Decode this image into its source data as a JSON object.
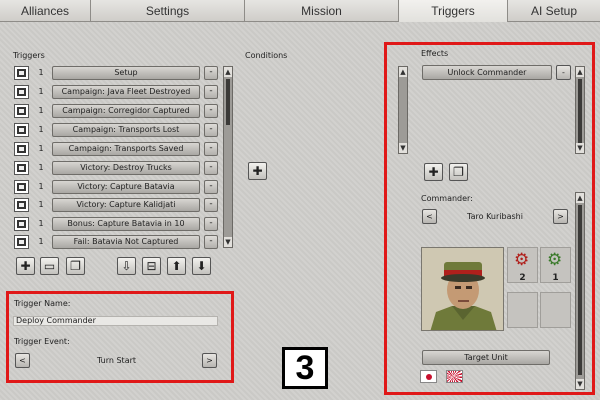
{
  "tabs": [
    {
      "label": "Alliances"
    },
    {
      "label": "Settings"
    },
    {
      "label": "Mission"
    },
    {
      "label": "Triggers"
    },
    {
      "label": "AI Setup"
    }
  ],
  "triggers_panel": {
    "heading": "Triggers",
    "rows": [
      {
        "number": "1",
        "label": "Setup"
      },
      {
        "number": "1",
        "label": "Campaign: Java Fleet Destroyed"
      },
      {
        "number": "1",
        "label": "Campaign: Corregidor Captured"
      },
      {
        "number": "1",
        "label": "Campaign: Transports Lost"
      },
      {
        "number": "1",
        "label": "Campaign: Transports Saved"
      },
      {
        "number": "1",
        "label": "Victory: Destroy Trucks"
      },
      {
        "number": "1",
        "label": "Victory: Capture Batavia"
      },
      {
        "number": "1",
        "label": "Victory: Capture Kalidjati"
      },
      {
        "number": "1",
        "label": "Bonus: Capture Batavia in 10"
      },
      {
        "number": "1",
        "label": "Fail: Batavia Not Captured"
      }
    ],
    "remove_label": "-"
  },
  "trigger_props": {
    "name_label": "Trigger Name:",
    "name_value": "Deploy Commander",
    "event_label": "Trigger Event:",
    "event_value": "Turn Start",
    "prev": "<",
    "next": ">"
  },
  "conditions": {
    "heading": "Conditions"
  },
  "effects": {
    "heading": "Effects",
    "items": [
      {
        "label": "Unlock Commander"
      }
    ],
    "remove_label": "-",
    "commander_label": "Commander:",
    "commander_name": "Taro Kuribashi",
    "prev": "<",
    "next": ">",
    "skill1_value": "2",
    "skill2_value": "1",
    "target_button": "Target Unit"
  },
  "badge": {
    "text": "3"
  },
  "colors": {
    "highlight_red": "#e01818",
    "gear_red": "#b0201c",
    "gear_green": "#3a7a2a"
  }
}
